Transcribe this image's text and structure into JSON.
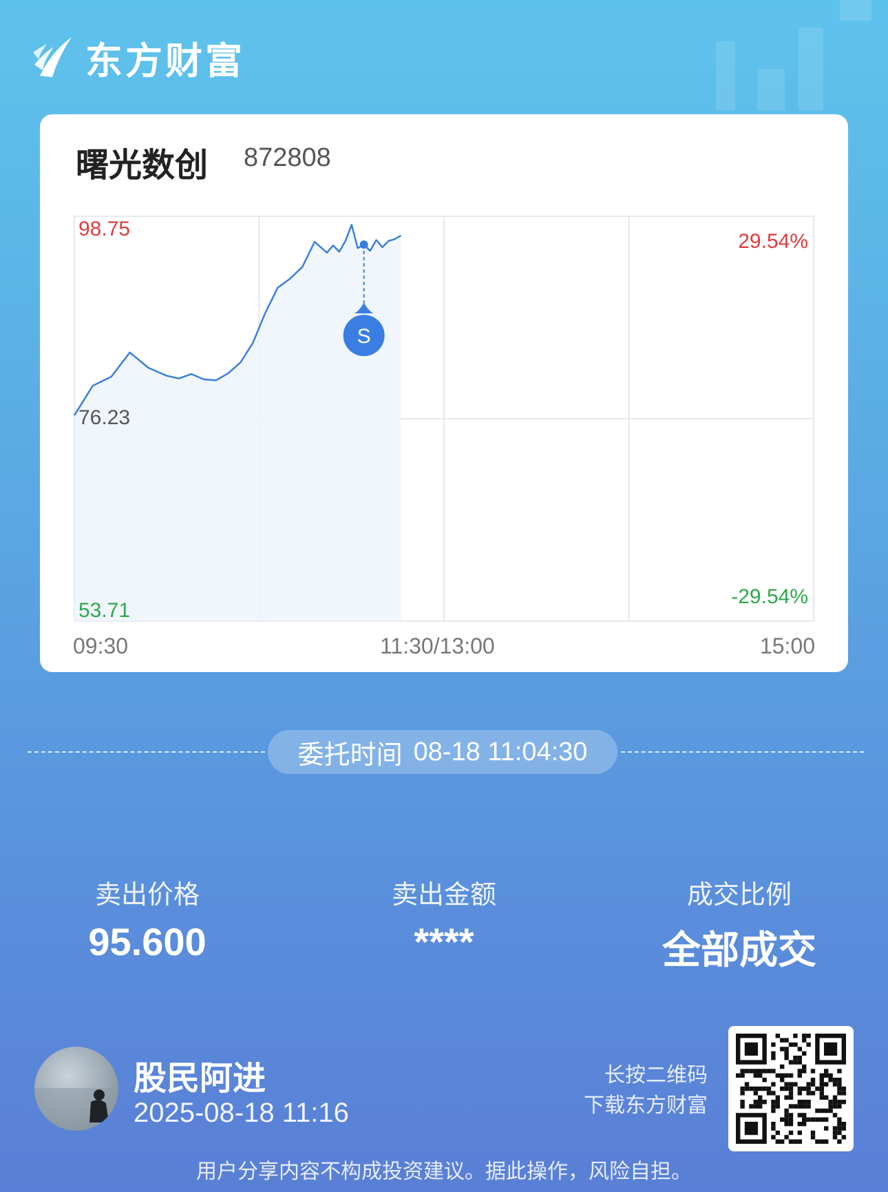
{
  "app": {
    "logo_text": "东方财富"
  },
  "stock": {
    "name": "曙光数创",
    "code": "872808"
  },
  "chart_data": {
    "type": "line",
    "x_ticks": [
      "09:30",
      "11:30/13:00",
      "15:00"
    ],
    "y_left_ticks": [
      "98.75",
      "76.23",
      "53.71"
    ],
    "y_right_ticks": [
      "29.54%",
      "-29.54%"
    ],
    "ylim": [
      53.71,
      98.75
    ],
    "grid": true,
    "series": [
      {
        "x": [
          "09:30",
          "09:36",
          "09:42",
          "09:48",
          "09:54",
          "10:00",
          "10:04",
          "10:08",
          "10:12",
          "10:16",
          "10:20",
          "10:24",
          "10:28",
          "10:32",
          "10:36",
          "10:40",
          "10:44",
          "10:48",
          "10:52",
          "10:54",
          "10:56",
          "10:58",
          "11:00",
          "11:02",
          "11:04",
          "11:06",
          "11:08",
          "11:10",
          "11:12",
          "11:14",
          "11:16"
        ],
        "values": [
          76.6,
          79.9,
          80.9,
          83.6,
          81.9,
          81.0,
          80.7,
          81.2,
          80.6,
          80.5,
          81.3,
          82.5,
          84.7,
          88.0,
          90.8,
          91.8,
          93.1,
          95.9,
          94.7,
          95.5,
          94.8,
          96.0,
          97.8,
          95.2,
          95.6,
          94.9,
          96.1,
          95.3,
          96.0,
          96.2,
          96.6
        ]
      }
    ],
    "annotations": [
      {
        "x": "11:04",
        "y": 95.6,
        "label": "S"
      }
    ]
  },
  "order": {
    "label": "委托时间",
    "time": "08-18 11:04:30"
  },
  "stats": [
    {
      "label": "卖出价格",
      "value": "95.600"
    },
    {
      "label": "卖出金额",
      "value": "****"
    },
    {
      "label": "成交比例",
      "value": "全部成交"
    }
  ],
  "user": {
    "name": "股民阿进",
    "datetime": "2025-08-18 11:16"
  },
  "qr": {
    "hint_line1": "长按二维码",
    "hint_line2": "下载东方财富"
  },
  "disclaimer": "用户分享内容不构成投资建议。据此操作，风险自担。",
  "colors": {
    "up": "#e23b3b",
    "down": "#2ea84c",
    "line": "#3b7fdc"
  }
}
